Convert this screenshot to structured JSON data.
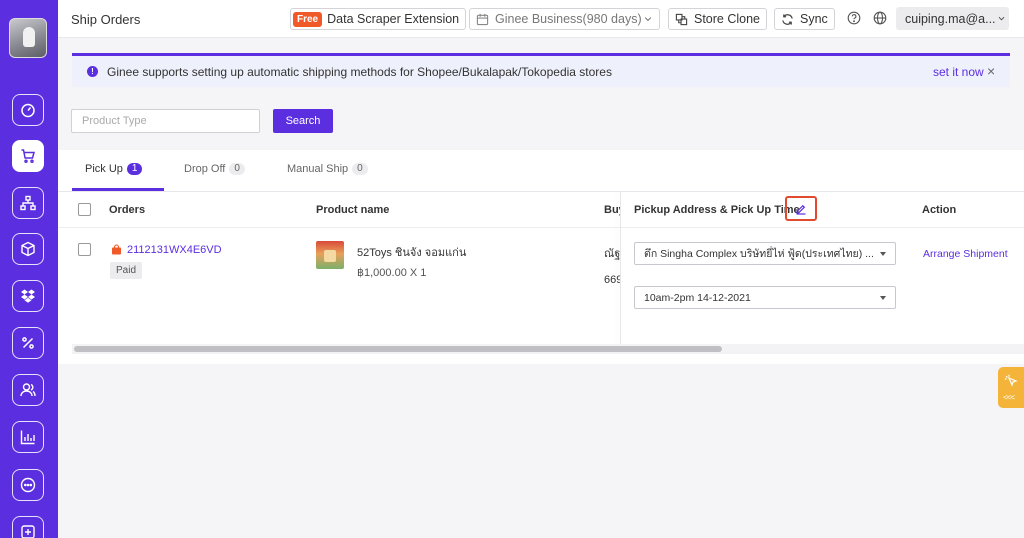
{
  "header": {
    "title": "Ship Orders",
    "free_badge": "Free",
    "data_scraper": "Data Scraper Extension",
    "business": "Ginee Business(980 days)",
    "store_clone": "Store Clone",
    "sync": "Sync",
    "user": "cuiping.ma@a..."
  },
  "notice": {
    "text": "Ginee supports setting up automatic shipping methods for Shopee/Bukalapak/Tokopedia stores",
    "action": "set it now",
    "close": "×"
  },
  "filter": {
    "placeholder": "Product Type",
    "search_label": "Search"
  },
  "tabs": [
    {
      "label": "Pick Up",
      "count": "1",
      "active": true
    },
    {
      "label": "Drop Off",
      "count": "0",
      "active": false
    },
    {
      "label": "Manual Ship",
      "count": "0",
      "active": false
    }
  ],
  "table": {
    "columns": {
      "orders": "Orders",
      "product": "Product name",
      "buyer": "Buy",
      "pickup": "Pickup Address & Pick Up Time",
      "action": "Action"
    },
    "rows": [
      {
        "order_id": "2112131WX4E6VD",
        "status": "Paid",
        "product_name": "52Toys ชินจัง จอมแก่น",
        "price_qty": "฿1,000.00 X 1",
        "buyer_line1": "ณัฐ",
        "buyer_line2": "669",
        "pickup_address": "ตึก Singha Complex บริษัทยี่ไห่ ฟู้ด(ประเทศไทย) ...",
        "pickup_time": "10am-2pm 14-12-2021",
        "action": "Arrange Shipment"
      }
    ]
  },
  "float_tab": {
    "arrows": "<<<"
  },
  "colors": {
    "brand": "#5b2ee0",
    "highlight": "#e14a2f",
    "free_badge": "#f05a28",
    "float_tab": "#f4b43a"
  },
  "icons": {
    "sidebar": [
      "dashboard-icon",
      "cart-icon",
      "hierarchy-icon",
      "box-icon",
      "dropbox-icon",
      "percent-icon",
      "users-icon",
      "chart-icon",
      "chat-icon",
      "add-icon"
    ]
  }
}
